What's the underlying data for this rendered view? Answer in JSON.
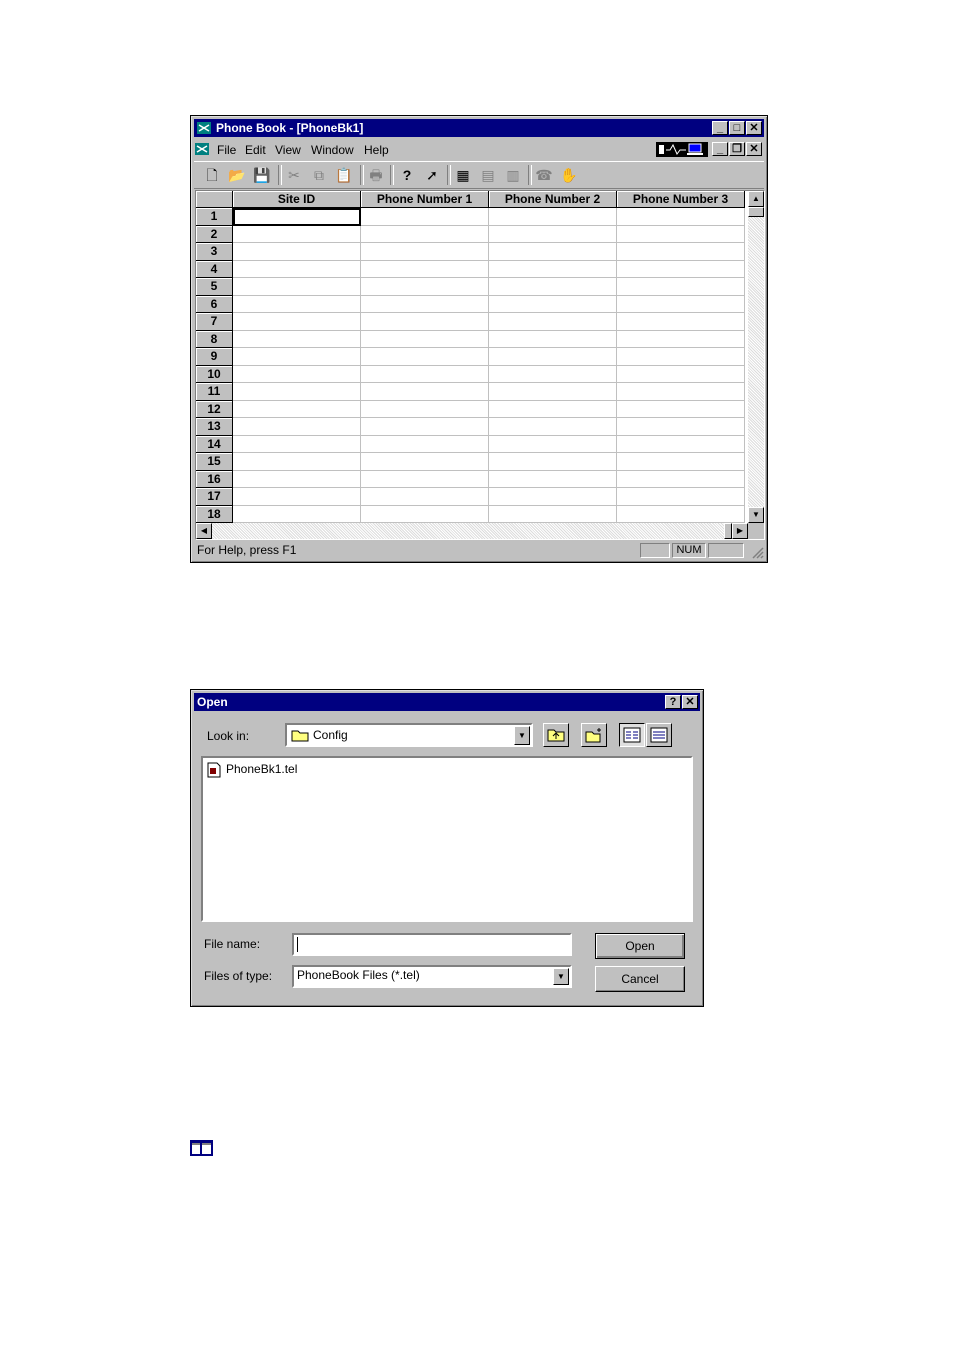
{
  "main_window": {
    "title": "Phone Book - [PhoneBk1]",
    "menu": [
      "File",
      "Edit",
      "View",
      "Window",
      "Help"
    ],
    "columns": [
      "Site ID",
      "Phone Number 1",
      "Phone Number 2",
      "Phone Number 3"
    ],
    "rows": [
      "1",
      "2",
      "3",
      "4",
      "5",
      "6",
      "7",
      "8",
      "9",
      "10",
      "11",
      "12",
      "13",
      "14",
      "15",
      "16",
      "17",
      "18"
    ],
    "status_text": "For Help, press F1",
    "status_num": "NUM"
  },
  "open_dialog": {
    "title": "Open",
    "help_glyph": "?",
    "look_in_label": "Look in:",
    "look_in_value": "Config",
    "files": [
      "PhoneBk1.tel"
    ],
    "file_name_label": "File name:",
    "file_name_value": "",
    "files_of_type_label": "Files of type:",
    "files_of_type_value": "PhoneBook Files (*.tel)",
    "open_button": "Open",
    "cancel_button": "Cancel"
  }
}
